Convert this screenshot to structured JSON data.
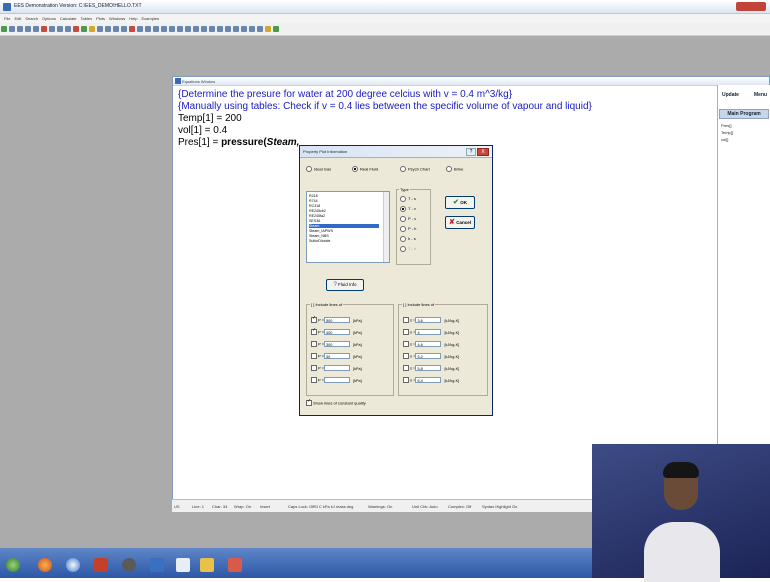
{
  "app": {
    "title": "EES Demonstration Version: C:\\EES_DEMO\\HELLO.TXT",
    "menu": [
      "File",
      "Edit",
      "Search",
      "Options",
      "Calculate",
      "Tables",
      "Plots",
      "Windows",
      "Help",
      "Examples"
    ]
  },
  "equations_window": {
    "title": "Equations Window",
    "lines": [
      "{Determine the presure for water at 200 degree celcius with v = 0.4 m^3/kg}",
      "{Manually using tables: Check if v = 0.4 lies between the specific volume of vapour and liquid}",
      "Temp[1] = 200",
      "vol[1] = 0.4",
      "Pres[1] = "
    ],
    "func_name": "pressure(",
    "func_arg": "Steam,"
  },
  "right_panel": {
    "tabs": [
      "Update",
      "Menu"
    ],
    "main_program": "Main Program",
    "vars": [
      "Pres[]",
      "Temp[]",
      "vol[]"
    ]
  },
  "status_bar": {
    "items": [
      "US",
      "Line: 1",
      "Char: 34",
      "Wrap: On",
      "Insert",
      "Caps Lock: Off",
      "SI C kPa kJ mass deg",
      "Warnings: On",
      "Unit Chk: Auto",
      "Complex: Off",
      "Syntax Highlight On"
    ]
  },
  "dialog": {
    "title": "Property Plot Information",
    "help_label": "?",
    "close_label": "X",
    "fluid_options": [
      {
        "label": "Ideal Gas",
        "selected": false
      },
      {
        "label": "Real Fluid",
        "selected": true
      },
      {
        "label": "Psych Chart",
        "selected": false
      },
      {
        "label": "Brine",
        "selected": false
      }
    ],
    "fluid_list": [
      "R218",
      "R744",
      "RC318",
      "RE245cb2",
      "RE245fa2",
      "SES36",
      "Steam",
      "Steam_IAPWS",
      "Steam_NBS",
      "SulfurDioxide"
    ],
    "fluid_selected_index": 6,
    "type_label": "Type",
    "types": [
      {
        "label": "T - s",
        "selected": false,
        "enabled": true
      },
      {
        "label": "T - v",
        "selected": true,
        "enabled": true
      },
      {
        "label": "P - v",
        "selected": false,
        "enabled": true
      },
      {
        "label": "P - h",
        "selected": false,
        "enabled": true
      },
      {
        "label": "h - s",
        "selected": false,
        "enabled": true
      },
      {
        "label": "T - h",
        "selected": false,
        "enabled": false
      }
    ],
    "ok_label": "OK",
    "cancel_label": "Cancel",
    "fluid_info_label": "Fluid Info",
    "pressure_group_label": "[ ] Include lines of",
    "pressure_lines": [
      {
        "var": "P =",
        "value": "500",
        "unit": "[kPa]",
        "checked": true
      },
      {
        "var": "P =",
        "value": "400",
        "unit": "[kPa]",
        "checked": true
      },
      {
        "var": "P =",
        "value": "300",
        "unit": "[kPa]",
        "checked": false
      },
      {
        "var": "P =",
        "value": "30",
        "unit": "[kPa]",
        "checked": false
      },
      {
        "var": "P =",
        "value": "",
        "unit": "[kPa]",
        "checked": false
      },
      {
        "var": "P =",
        "value": "",
        "unit": "[kPa]",
        "checked": false
      }
    ],
    "entropy_group_label": "[ ] Include lines of",
    "entropy_lines": [
      {
        "var": "s =",
        "value": "3.6",
        "unit": "[kJ/kg-K]",
        "checked": false
      },
      {
        "var": "s =",
        "value": "4",
        "unit": "[kJ/kg-K]",
        "checked": false
      },
      {
        "var": "s =",
        "value": "4.6",
        "unit": "[kJ/kg-K]",
        "checked": false
      },
      {
        "var": "s =",
        "value": "5.2",
        "unit": "[kJ/kg-K]",
        "checked": false
      },
      {
        "var": "s =",
        "value": "5.8",
        "unit": "[kJ/kg-K]",
        "checked": false
      },
      {
        "var": "s =",
        "value": "6.4",
        "unit": "[kJ/kg-K]",
        "checked": false
      }
    ],
    "quality_label": "Show lines of constant quality",
    "quality_checked": true
  }
}
